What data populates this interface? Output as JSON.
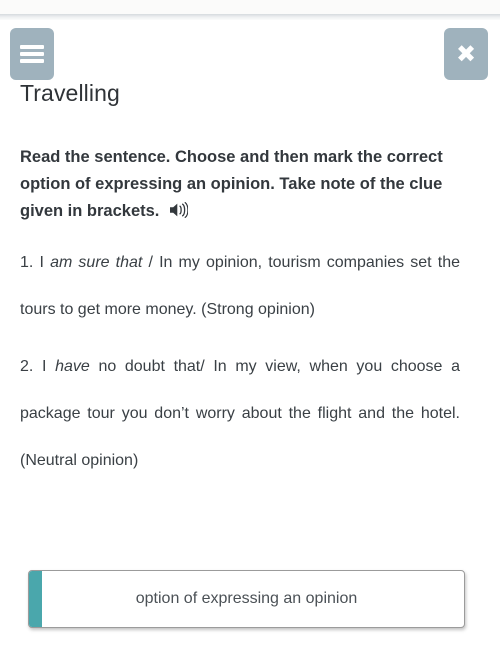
{
  "window": {
    "top_strip_color": "#fbfbfa"
  },
  "header": {
    "menu_button": {
      "name": "menu",
      "icon": "hamburger-icon",
      "bg_color": "#9fb2bd"
    },
    "close_button": {
      "name": "close",
      "icon": "close-icon",
      "label": "✖",
      "bg_color": "#9fb2bd"
    }
  },
  "page": {
    "title": "Travelling"
  },
  "instruction": {
    "text": "Read the sentence. Choose and then mark the correct option of expressing an opinion. Take note of the clue given in brackets.",
    "audio_icon": "speaker-icon"
  },
  "questions": [
    {
      "number": "1.",
      "parts": [
        {
          "text": "I ",
          "style": "normal"
        },
        {
          "text": "am sure that",
          "style": "italic"
        },
        {
          "text": " / In my opinion, tourism companies set the tours to get more money. (Strong opinion)",
          "style": "normal"
        }
      ],
      "plain": "1. I am sure that / In my opinion, tourism companies set the tours to get more money. (Strong opinion)"
    },
    {
      "number": "2.",
      "parts": [
        {
          "text": "I ",
          "style": "normal"
        },
        {
          "text": "have",
          "style": "italic"
        },
        {
          "text": " no doubt that/ In my view, when you choose a package tour you don’t worry about the flight and the hotel. (Neutral opinion)",
          "style": "normal"
        }
      ],
      "plain": "2. I have no doubt that/ In my view, when you choose a package tour you don’t worry about the flight and the hotel. (Neutral opinion)"
    }
  ],
  "options": [
    {
      "label": "option of expressing an opinion",
      "accent_color": "#4aa7ac",
      "selected": false
    }
  ]
}
